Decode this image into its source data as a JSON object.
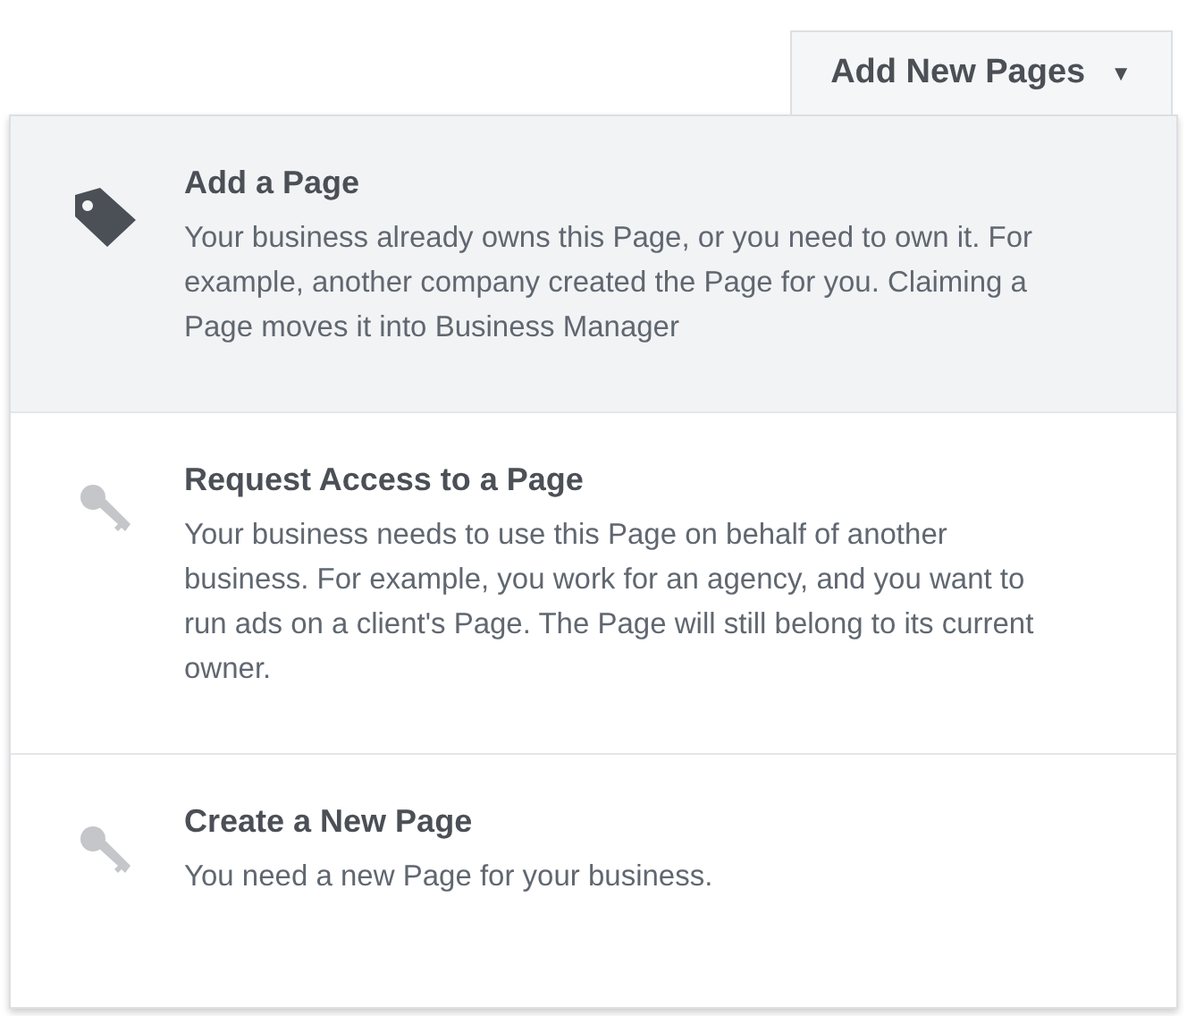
{
  "button": {
    "label": "Add New Pages",
    "caret": "▼"
  },
  "menu": [
    {
      "kind": "tag",
      "selected": true,
      "title": "Add a Page",
      "description": "Your business already owns this Page, or you need to own it. For example, another company created the Page for you. Claiming a Page moves it into Business Manager"
    },
    {
      "kind": "key",
      "selected": false,
      "title": "Request Access to a Page",
      "description": "Your business needs to use this Page on behalf of another business. For example, you work for an agency, and you want to run ads on a client's Page. The Page will still belong to its current owner."
    },
    {
      "kind": "key",
      "selected": false,
      "title": "Create a New Page",
      "description": "You need a new Page for your business."
    }
  ]
}
